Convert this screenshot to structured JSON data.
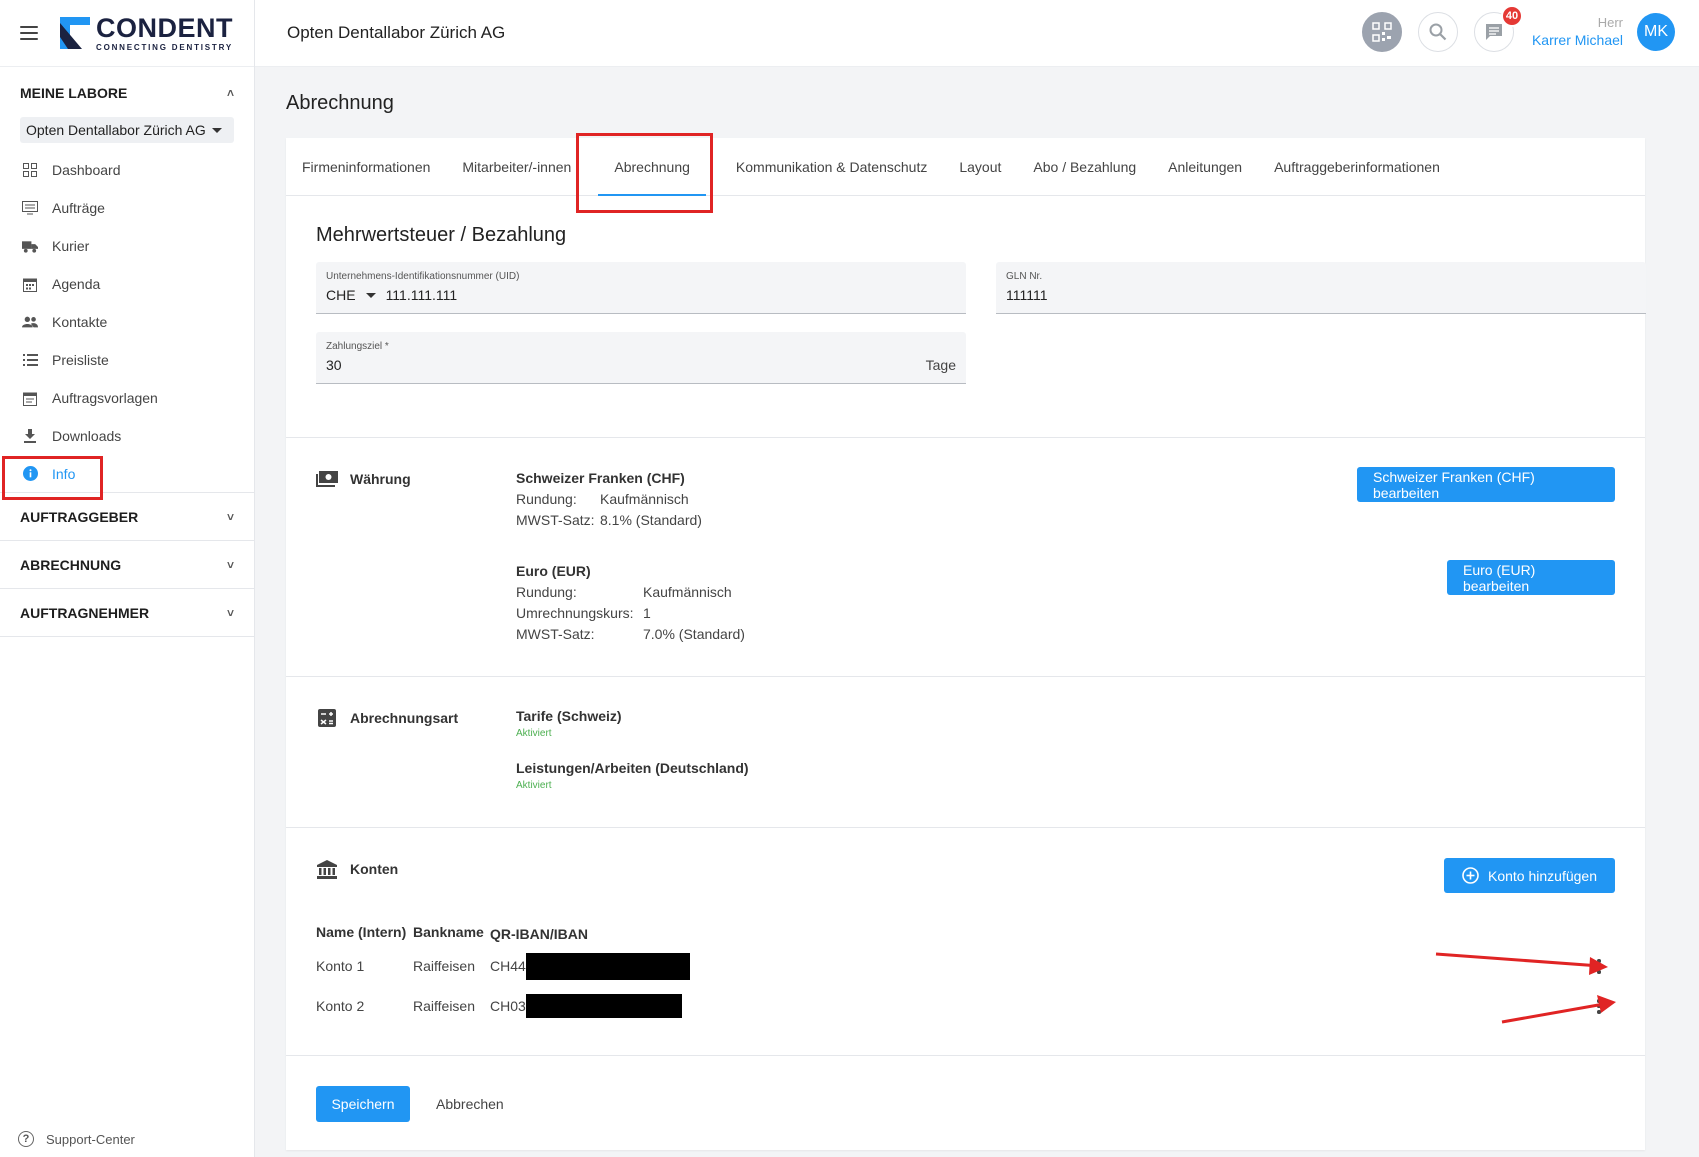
{
  "brand": {
    "name": "CONDENT",
    "tagline": "CONNECTING DENTISTRY"
  },
  "colors": {
    "accent": "#2196f3",
    "badge": "#e53935",
    "success": "#4caf50",
    "annotation": "#e02424"
  },
  "sidebar": {
    "meine_labore": "MEINE LABORE",
    "lab_select": "Opten Dentallabor Zürich AG",
    "items": [
      {
        "label": "Dashboard",
        "icon": "dashboard-icon"
      },
      {
        "label": "Aufträge",
        "icon": "orders-icon"
      },
      {
        "label": "Kurier",
        "icon": "truck-icon"
      },
      {
        "label": "Agenda",
        "icon": "calendar-icon"
      },
      {
        "label": "Kontakte",
        "icon": "people-icon"
      },
      {
        "label": "Preisliste",
        "icon": "list-icon"
      },
      {
        "label": "Auftragsvorlagen",
        "icon": "template-icon"
      },
      {
        "label": "Downloads",
        "icon": "download-icon"
      },
      {
        "label": "Info",
        "icon": "info-icon",
        "active": true
      }
    ],
    "sections": [
      "AUFTRAGGEBER",
      "ABRECHNUNG",
      "AUFTRAGNEHMER"
    ],
    "support": "Support-Center"
  },
  "topbar": {
    "company": "Opten Dentallabor Zürich AG",
    "notifications_count": "40",
    "salutation": "Herr",
    "user_name": "Karrer Michael",
    "avatar_initials": "MK"
  },
  "page": {
    "title": "Abrechnung",
    "tabs": [
      "Firmeninformationen",
      "Mitarbeiter/-innen",
      "Abrechnung",
      "Kommunikation & Datenschutz",
      "Layout",
      "Abo / Bezahlung",
      "Anleitungen",
      "Auftraggeberinformationen"
    ],
    "active_tab": "Abrechnung"
  },
  "vat": {
    "title": "Mehrwertsteuer / Bezahlung",
    "uid_label": "Unternehmens-Identifikationsnummer (UID)",
    "uid_prefix": "CHE",
    "uid_value": "111.111.111",
    "gln_label": "GLN Nr.",
    "gln_value": "111111",
    "payment_label": "Zahlungsziel *",
    "payment_value": "30",
    "payment_suffix": "Tage"
  },
  "currency": {
    "label": "Währung",
    "chf": {
      "title": "Schweizer Franken (CHF)",
      "rounding_key": "Rundung:",
      "rounding_val": "Kaufmännisch",
      "vat_key": "MWST-Satz:",
      "vat_val": "8.1% (Standard)",
      "button": "Schweizer Franken (CHF) bearbeiten"
    },
    "eur": {
      "title": "Euro (EUR)",
      "rounding_key": "Rundung:",
      "rounding_val": "Kaufmännisch",
      "rate_key": "Umrechnungskurs:",
      "rate_val": "1",
      "vat_key": "MWST-Satz:",
      "vat_val": "7.0% (Standard)",
      "button": "Euro (EUR) bearbeiten"
    }
  },
  "billing": {
    "label": "Abrechnungsart",
    "types": [
      {
        "title": "Tarife (Schweiz)",
        "status": "Aktiviert"
      },
      {
        "title": "Leistungen/Arbeiten (Deutschland)",
        "status": "Aktiviert"
      }
    ]
  },
  "accounts": {
    "label": "Konten",
    "add_button": "Konto hinzufügen",
    "headers": [
      "Name (Intern)",
      "Bankname",
      "QR-IBAN/IBAN"
    ],
    "rows": [
      {
        "name": "Konto 1",
        "bank": "Raiffeisen",
        "iban": "CH44"
      },
      {
        "name": "Konto 2",
        "bank": "Raiffeisen",
        "iban": "CH03"
      }
    ]
  },
  "actions": {
    "save": "Speichern",
    "cancel": "Abbrechen"
  }
}
